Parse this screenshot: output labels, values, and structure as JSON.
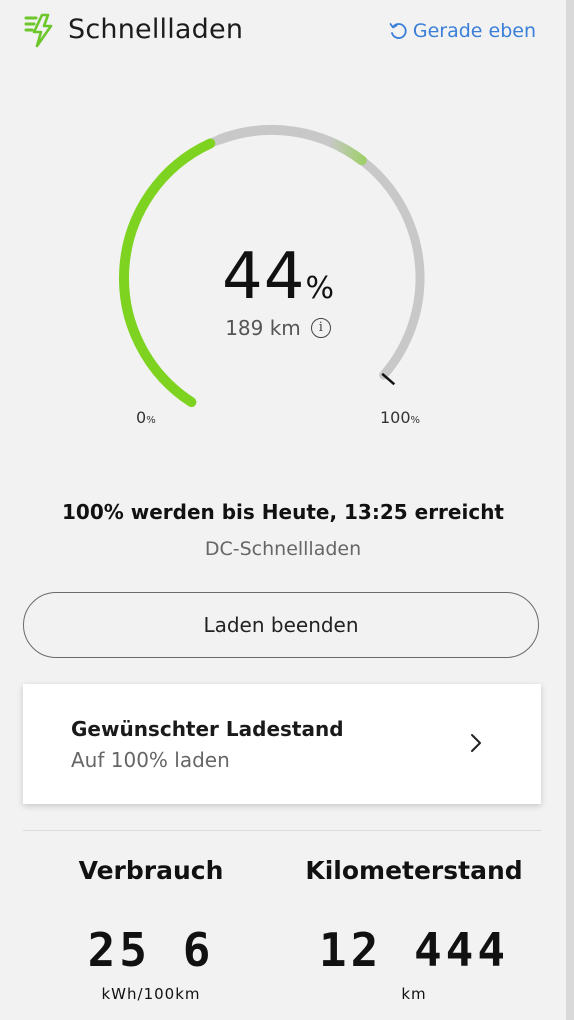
{
  "header": {
    "title": "Schnellladen",
    "refresh_label": "Gerade eben",
    "icon": "lightning-charging-icon"
  },
  "gauge": {
    "percent_value": "44",
    "percent_unit": "%",
    "range_text": "189 km",
    "min_label": "0",
    "max_label": "100",
    "min_unit": "%",
    "max_unit": "%",
    "charge_fraction": 0.44,
    "accent_color": "#7ed321",
    "track_color": "#c8c8c8"
  },
  "status": {
    "eta_text": "100% werden bis Heute, 13:25 erreicht",
    "mode_text": "DC-Schnellladen"
  },
  "actions": {
    "stop_label": "Laden beenden"
  },
  "target_card": {
    "title": "Gewünschter Ladestand",
    "subtitle": "Auf 100% laden"
  },
  "stats": {
    "consumption": {
      "title": "Verbrauch",
      "value": "25 6",
      "unit": "kWh/100km"
    },
    "odometer": {
      "title": "Kilometerstand",
      "value": "12 444",
      "unit": "km"
    }
  }
}
